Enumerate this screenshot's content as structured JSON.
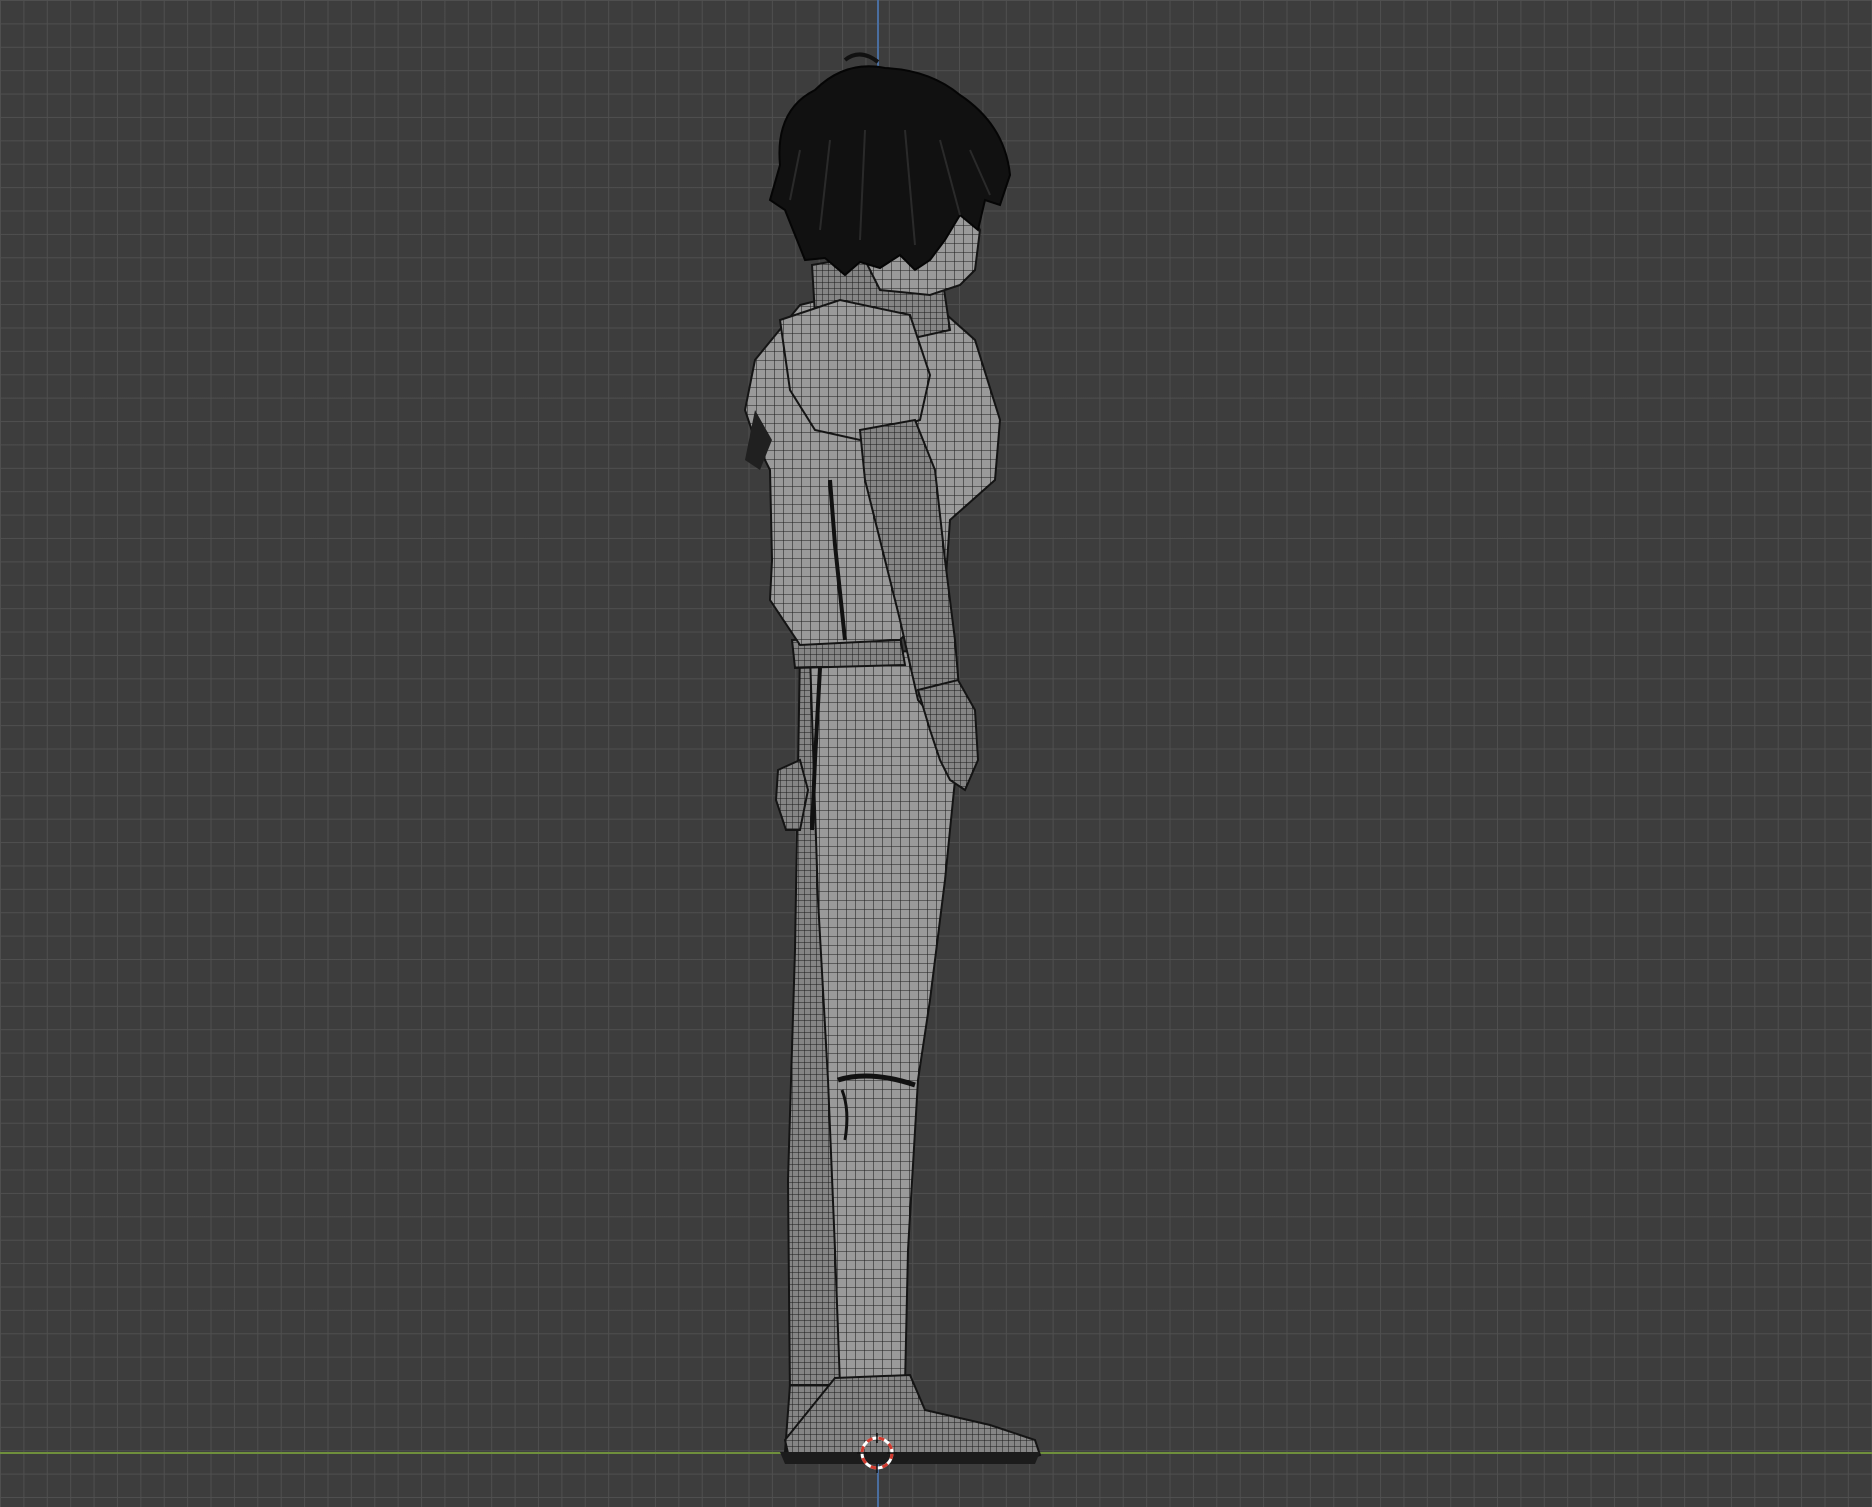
{
  "viewport": {
    "background_color": "#3d3d3d",
    "grid_color": "#505050",
    "z_axis_color": "#4a6ea0",
    "x_axis_color": "#6f8f3c",
    "shading_mode": "wireframe-over-solid"
  },
  "scene": {
    "object": "character-mesh",
    "view": "side-orthographic",
    "hair_color": "#111111",
    "mesh_base_color": "#8a8a8a",
    "wire_color": "#1a1a1a"
  },
  "cursor": {
    "icon": "3d-cursor-icon",
    "colors": [
      "#d23a2e",
      "#ffffff"
    ]
  }
}
